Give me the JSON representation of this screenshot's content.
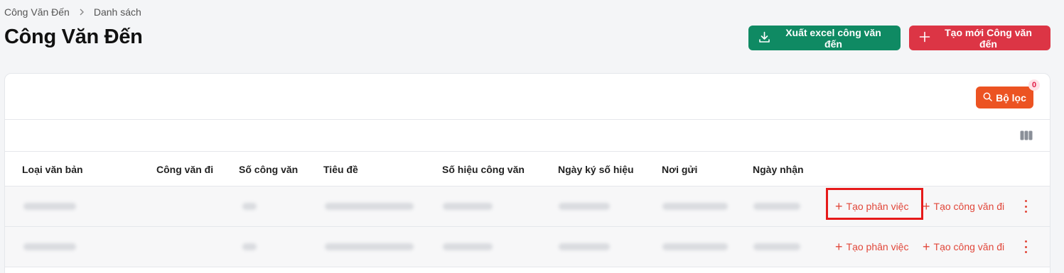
{
  "breadcrumb": {
    "root": "Công Văn Đến",
    "current": "Danh sách"
  },
  "page_title": "Công Văn Đến",
  "actions": {
    "export_label": "Xuất excel công văn đến",
    "create_label": "Tạo mới Công văn đến"
  },
  "filter": {
    "label": "Bộ lọc",
    "count": "0"
  },
  "table": {
    "headers": [
      "Loại văn bản",
      "Công văn đi",
      "Số công văn",
      "Tiêu đề",
      "Số hiệu công văn",
      "Ngày ký số hiệu",
      "Nơi gửi",
      "Ngày nhận"
    ],
    "row_actions": {
      "task": "Tạo phân việc",
      "outgoing": "Tạo công văn đi"
    }
  },
  "colors": {
    "export": "#0f8a63",
    "create": "#dc3545",
    "filter": "#ec5322",
    "action_text": "#e1473a",
    "highlight": "#e61a1a"
  },
  "icons": [
    "chevron-right-icon",
    "download-icon",
    "plus-icon",
    "search-icon",
    "columns-icon",
    "kebab-icon"
  ]
}
